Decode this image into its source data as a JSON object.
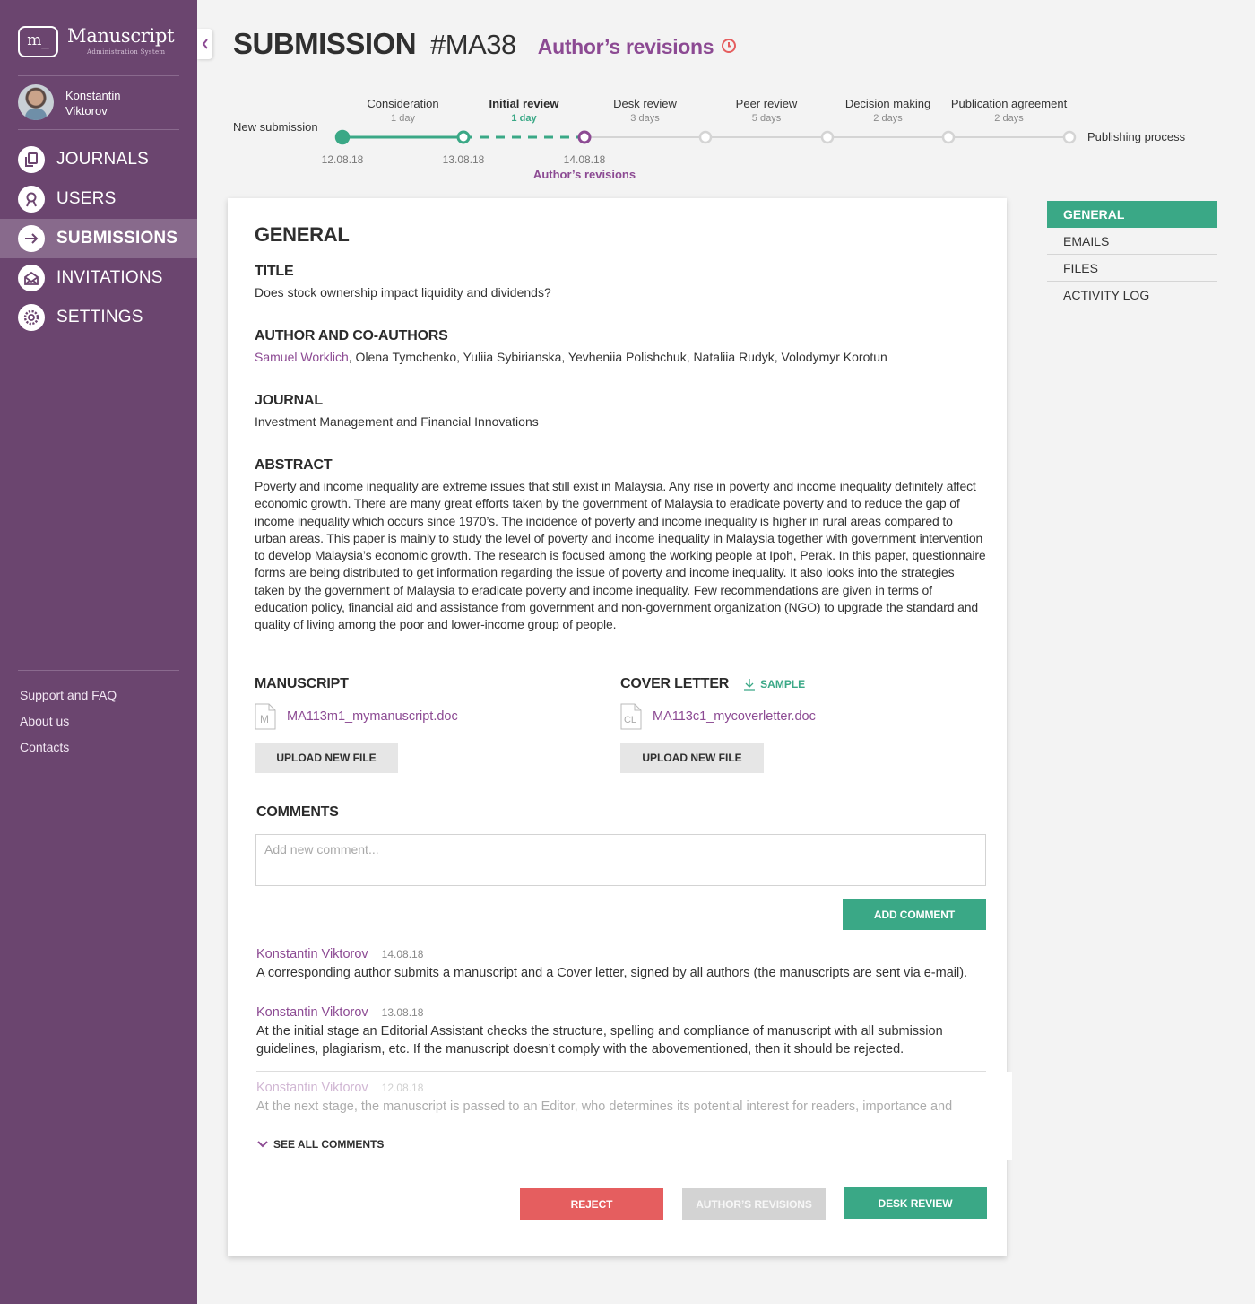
{
  "app": {
    "logo_mark": "m_",
    "name": "Manuscript",
    "subtitle": "Administration System"
  },
  "user": {
    "first_name": "Konstantin",
    "last_name": "Viktorov"
  },
  "sidebar": {
    "items": [
      {
        "label": "JOURNALS",
        "icon": "journals-icon",
        "active": false
      },
      {
        "label": "USERS",
        "icon": "user-icon",
        "active": false
      },
      {
        "label": "SUBMISSIONS",
        "icon": "arrow-right-icon",
        "active": true
      },
      {
        "label": "INVITATIONS",
        "icon": "envelope-icon",
        "active": false
      },
      {
        "label": "SETTINGS",
        "icon": "gear-icon",
        "active": false
      }
    ],
    "footer_links": [
      "Support and FAQ",
      "About us",
      "Contacts"
    ]
  },
  "header": {
    "title": "SUBMISSION",
    "id": "#MA38",
    "status": "Author’s revisions",
    "status_icon": "clock-icon"
  },
  "timeline": {
    "start_label": "New submission",
    "end_label": "Publishing process",
    "stages": [
      {
        "name": "Consideration",
        "duration": "1 day",
        "state": "done"
      },
      {
        "name": "Initial review",
        "duration": "1 day",
        "state": "current"
      },
      {
        "name": "Desk review",
        "duration": "3 days",
        "state": "pending"
      },
      {
        "name": "Peer review",
        "duration": "5 days",
        "state": "pending"
      },
      {
        "name": "Decision making",
        "duration": "2 days",
        "state": "pending"
      },
      {
        "name": "Publication agreement",
        "duration": "2 days",
        "state": "pending"
      }
    ],
    "dates": [
      "12.08.18",
      "13.08.18",
      "14.08.18"
    ],
    "current_point_label": "Author’s revisions",
    "colors": {
      "done": "#3aa886",
      "current": "#8c4a93",
      "pending": "#d4d4d4"
    }
  },
  "general": {
    "heading": "GENERAL",
    "title_label": "TITLE",
    "title_value": "Does stock ownership impact liquidity and dividends?",
    "authors_label": "AUTHOR AND CO-AUTHORS",
    "main_author": "Samuel Worklich",
    "co_authors": ", Olena Tymchenko, Yuliia Sybirianska, Yevheniia Polishchuk, Nataliia Rudyk, Volodymyr Korotun",
    "journal_label": "JOURNAL",
    "journal_value": "Investment Management and Financial Innovations",
    "abstract_label": "ABSTRACT",
    "abstract_value": "Poverty and income inequality are extreme issues that still exist in Malaysia. Any rise in poverty and income inequality definitely affect economic growth. There are many great efforts taken by the government of Malaysia to eradicate poverty and to reduce the gap of income inequality which occurs since 1970’s. The incidence of poverty and income inequality is higher in rural areas compared to urban areas. This paper is mainly to study the level of poverty and income inequality in Malaysia together with government intervention to develop Malaysia’s economic growth. The research is focused among the working people at Ipoh, Perak. In this paper, questionnaire forms are being distributed to get information regarding the issue of poverty and income inequality. It also looks into the strategies taken by the government of Malaysia to eradicate poverty and income inequality. Few recommendations are given in terms of education policy, financial aid and assistance from government and non-government organization (NGO) to upgrade the standard and quality of living among the poor and lower-income group of people.",
    "manuscript": {
      "label": "MANUSCRIPT",
      "file_badge": "M",
      "file_name": "MA113m1_mymanuscript.doc",
      "upload_label": "UPLOAD NEW FILE"
    },
    "cover_letter": {
      "label": "COVER LETTER",
      "sample_label": "SAMPLE",
      "file_badge": "CL",
      "file_name": "MA113c1_mycoverletter.doc",
      "upload_label": "UPLOAD NEW FILE"
    }
  },
  "comments": {
    "label": "COMMENTS",
    "placeholder": "Add new comment...",
    "input_value": "",
    "add_label": "ADD COMMENT",
    "items": [
      {
        "author": "Konstantin Viktorov",
        "date": "14.08.18",
        "text": "A corresponding author submits a manuscript and a Cover letter, signed by all authors (the manuscripts are sent via e-mail)."
      },
      {
        "author": "Konstantin Viktorov",
        "date": "13.08.18",
        "text": "At the initial stage an Editorial Assistant checks the structure, spelling and compliance of manuscript with all submission guidelines, plagiarism, etc. If the manuscript doesn’t comply with the abovementioned, then it should be rejected."
      },
      {
        "author": "Konstantin Viktorov",
        "date": "12.08.18",
        "text": "At the next stage, the manuscript is passed to an Editor, who determines its potential interest for readers, importance and relevance of a scientific..."
      }
    ],
    "see_all_label": "SEE ALL COMMENTS"
  },
  "actions": {
    "reject": "REJECT",
    "authors_revisions": "AUTHOR’S REVISIONS",
    "desk_review": "DESK REVIEW"
  },
  "side_tabs": [
    {
      "label": "GENERAL",
      "active": true
    },
    {
      "label": "EMAILS",
      "active": false
    },
    {
      "label": "FILES",
      "active": false
    },
    {
      "label": "ACTIVITY LOG",
      "active": false
    }
  ],
  "colors": {
    "sidebar": "#6b456f",
    "accent_purple": "#8c4a93",
    "accent_green": "#3aa886",
    "danger": "#e55e5f"
  }
}
